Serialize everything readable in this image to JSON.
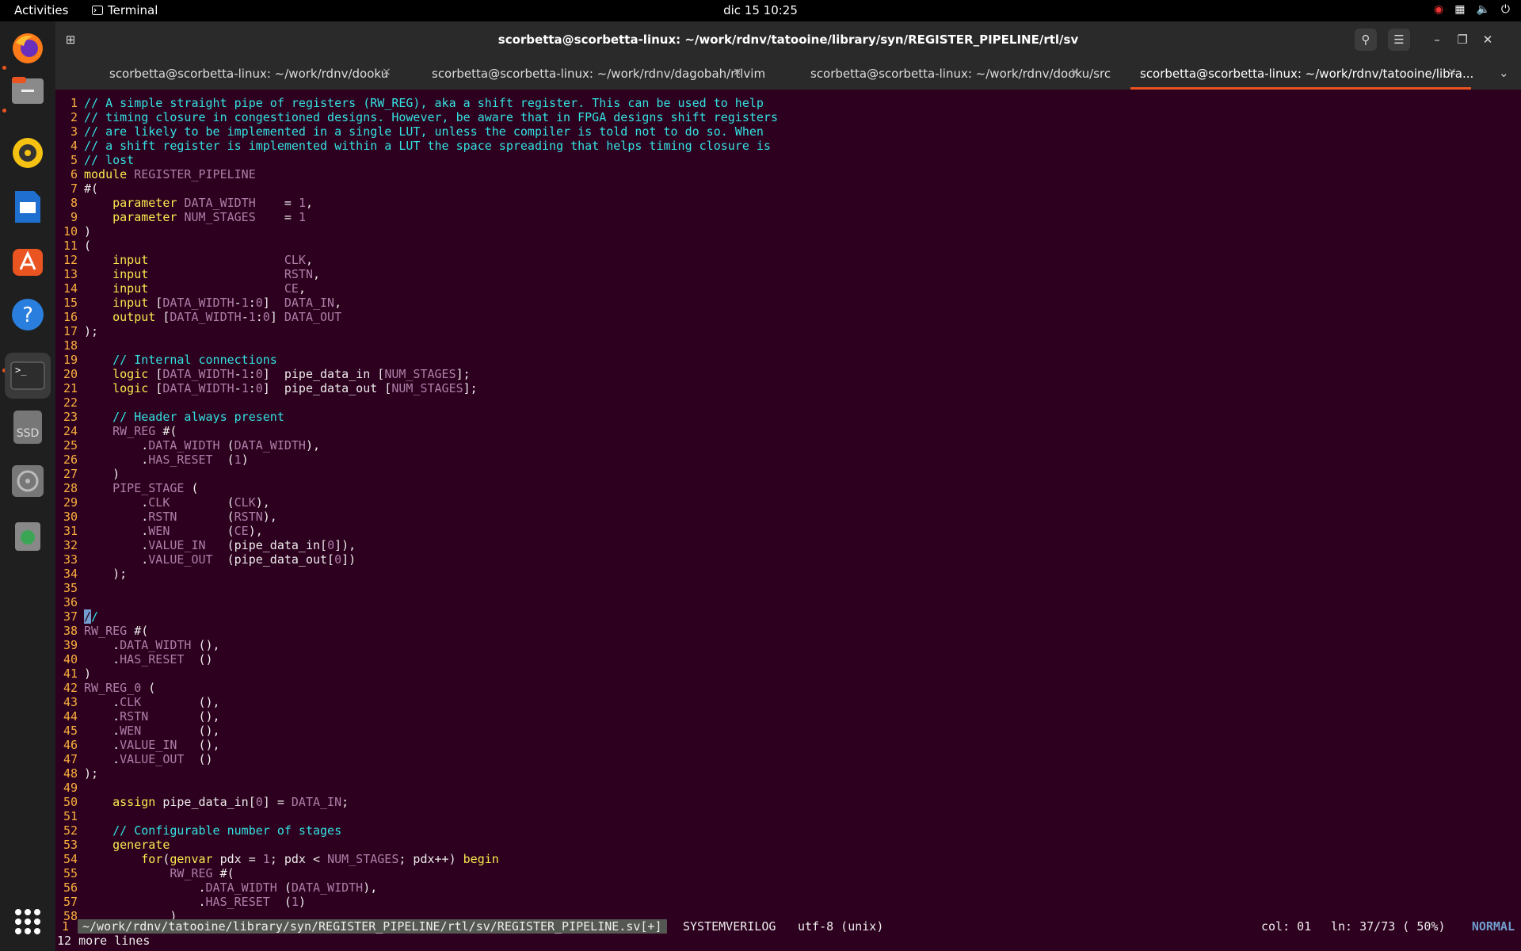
{
  "topbar": {
    "activities": "Activities",
    "app": "Terminal",
    "clock": "dic 15  10:25",
    "tray_icons": [
      "discord-icon",
      "network-icon",
      "volume-icon",
      "power-icon"
    ]
  },
  "dock": {
    "apps": [
      "firefox-icon",
      "files-icon",
      "rhythmbox-icon",
      "writer-icon",
      "software-icon",
      "help-icon",
      "terminal-icon",
      "ssd-drive-icon",
      "optical-drive-icon",
      "trash-icon",
      "app-grid-icon"
    ],
    "ssd_label": "SSD"
  },
  "window": {
    "title": "scorbetta@scorbetta-linux: ~/work/rdnv/tatooine/library/syn/REGISTER_PIPELINE/rtl/sv"
  },
  "tabs": [
    {
      "label": "scorbetta@scorbetta-linux: ~/work/rdnv/dooku",
      "close": "×"
    },
    {
      "label": "scorbetta@scorbetta-linux: ~/work/rdnv/dagobah/rtlvim",
      "close": "×"
    },
    {
      "label": "scorbetta@scorbetta-linux: ~/work/rdnv/dooku/src",
      "close": "×"
    },
    {
      "label": "scorbetta@scorbetta-linux: ~/work/rdnv/tatooine/libra...",
      "close": "×"
    }
  ],
  "code_lines": [
    {
      "n": "1",
      "t": "// A simple straight pipe of registers (RW_REG), aka a shift register. This can be used to help"
    },
    {
      "n": "2",
      "t": "// timing closure in congestioned designs. However, be aware that in FPGA designs shift registers"
    },
    {
      "n": "3",
      "t": "// are likely to be implemented in a single LUT, unless the compiler is told not to do so. When"
    },
    {
      "n": "4",
      "t": "// a shift register is implemented within a LUT the space spreading that helps timing closure is"
    },
    {
      "n": "5",
      "t": "// lost"
    },
    {
      "n": "6",
      "t": "module REGISTER_PIPELINE"
    },
    {
      "n": "7",
      "t": "#("
    },
    {
      "n": "8",
      "t": "    parameter DATA_WIDTH    = 1,"
    },
    {
      "n": "9",
      "t": "    parameter NUM_STAGES    = 1"
    },
    {
      "n": "10",
      "t": ")"
    },
    {
      "n": "11",
      "t": "("
    },
    {
      "n": "12",
      "t": "    input                   CLK,"
    },
    {
      "n": "13",
      "t": "    input                   RSTN,"
    },
    {
      "n": "14",
      "t": "    input                   CE,"
    },
    {
      "n": "15",
      "t": "    input [DATA_WIDTH-1:0]  DATA_IN,"
    },
    {
      "n": "16",
      "t": "    output [DATA_WIDTH-1:0] DATA_OUT"
    },
    {
      "n": "17",
      "t": ");"
    },
    {
      "n": "18",
      "t": ""
    },
    {
      "n": "19",
      "t": "    // Internal connections"
    },
    {
      "n": "20",
      "t": "    logic [DATA_WIDTH-1:0]  pipe_data_in [NUM_STAGES];"
    },
    {
      "n": "21",
      "t": "    logic [DATA_WIDTH-1:0]  pipe_data_out [NUM_STAGES];"
    },
    {
      "n": "22",
      "t": ""
    },
    {
      "n": "23",
      "t": "    // Header always present"
    },
    {
      "n": "24",
      "t": "    RW_REG #("
    },
    {
      "n": "25",
      "t": "        .DATA_WIDTH (DATA_WIDTH),"
    },
    {
      "n": "26",
      "t": "        .HAS_RESET  (1)"
    },
    {
      "n": "27",
      "t": "    )"
    },
    {
      "n": "28",
      "t": "    PIPE_STAGE ("
    },
    {
      "n": "29",
      "t": "        .CLK        (CLK),"
    },
    {
      "n": "30",
      "t": "        .RSTN       (RSTN),"
    },
    {
      "n": "31",
      "t": "        .WEN        (CE),"
    },
    {
      "n": "32",
      "t": "        .VALUE_IN   (pipe_data_in[0]),"
    },
    {
      "n": "33",
      "t": "        .VALUE_OUT  (pipe_data_out[0])"
    },
    {
      "n": "34",
      "t": "    );"
    },
    {
      "n": "35",
      "t": ""
    },
    {
      "n": "36",
      "t": ""
    },
    {
      "n": "37",
      "t": "//"
    },
    {
      "n": "38",
      "t": "RW_REG #("
    },
    {
      "n": "39",
      "t": "    .DATA_WIDTH (),"
    },
    {
      "n": "40",
      "t": "    .HAS_RESET  ()"
    },
    {
      "n": "41",
      "t": ")"
    },
    {
      "n": "42",
      "t": "RW_REG_0 ("
    },
    {
      "n": "43",
      "t": "    .CLK        (),"
    },
    {
      "n": "44",
      "t": "    .RSTN       (),"
    },
    {
      "n": "45",
      "t": "    .WEN        (),"
    },
    {
      "n": "46",
      "t": "    .VALUE_IN   (),"
    },
    {
      "n": "47",
      "t": "    .VALUE_OUT  ()"
    },
    {
      "n": "48",
      "t": ");"
    },
    {
      "n": "49",
      "t": ""
    },
    {
      "n": "50",
      "t": "    assign pipe_data_in[0] = DATA_IN;"
    },
    {
      "n": "51",
      "t": ""
    },
    {
      "n": "52",
      "t": "    // Configurable number of stages"
    },
    {
      "n": "53",
      "t": "    generate"
    },
    {
      "n": "54",
      "t": "        for(genvar pdx = 1; pdx < NUM_STAGES; pdx++) begin"
    },
    {
      "n": "55",
      "t": "            RW_REG #("
    },
    {
      "n": "56",
      "t": "                .DATA_WIDTH (DATA_WIDTH),"
    },
    {
      "n": "57",
      "t": "                .HAS_RESET  (1)"
    },
    {
      "n": "58",
      "t": "            )"
    }
  ],
  "statusline": {
    "bufnum": "1",
    "file": "~/work/rdnv/tatooine/library/syn/REGISTER_PIPELINE/rtl/sv/REGISTER_PIPELINE.sv[+]",
    "filetype": "SYSTEMVERILOG",
    "encoding": "utf-8 (unix)",
    "col": "col: 01",
    "pos": "ln: 37/73 ( 50%)",
    "mode": "NORMAL"
  },
  "cmdline": "12 more lines"
}
